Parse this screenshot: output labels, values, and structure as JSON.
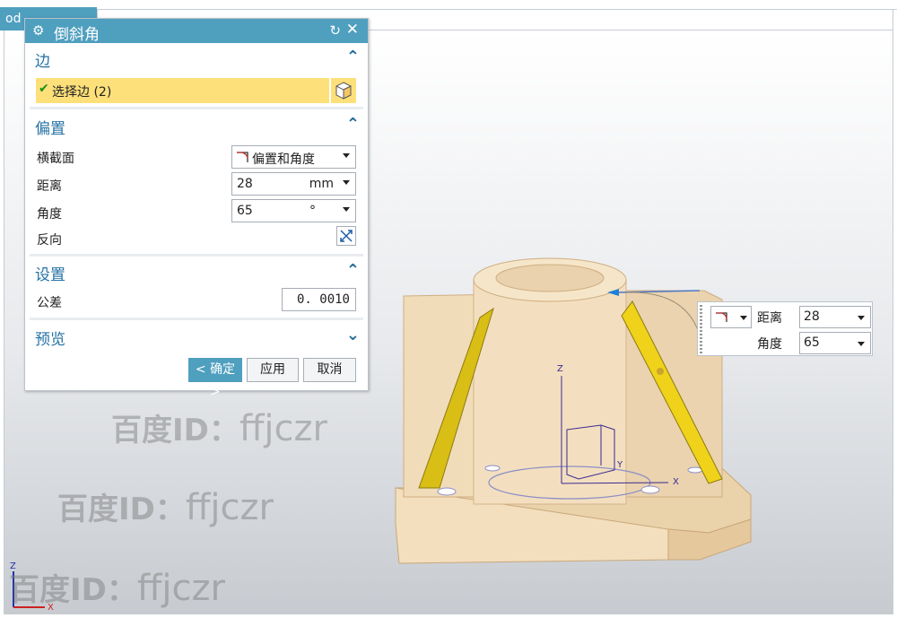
{
  "tab": {
    "doc_label": "od"
  },
  "dialog": {
    "title": "倒斜角",
    "sections": {
      "edge": {
        "title": "边",
        "select_label": "选择边 (2)"
      },
      "offset": {
        "title": "偏置",
        "cross_section_label": "横截面",
        "cross_section_value": "偏置和角度",
        "distance_label": "距离",
        "distance_value": "28",
        "distance_unit": "mm",
        "angle_label": "角度",
        "angle_value": "65",
        "angle_unit": "°",
        "reverse_label": "反向"
      },
      "settings": {
        "title": "设置",
        "tolerance_label": "公差",
        "tolerance_value": "0. 0010"
      },
      "preview": {
        "title": "预览"
      }
    },
    "buttons": {
      "ok": "< 确定 >",
      "apply": "应用",
      "cancel": "取消"
    }
  },
  "onscreen_input": {
    "distance_label": "距离",
    "distance_value": "28",
    "angle_label": "角度",
    "angle_value": "65"
  },
  "triad": {
    "x": "X",
    "y": "Y",
    "z": "Z"
  },
  "watermarks": [
    {
      "cn": "百度ID：",
      "latin": "ffjczr"
    },
    {
      "cn": "百度ID：",
      "latin": "ffjczr"
    },
    {
      "cn": "百度ID：",
      "latin": "ffjczr"
    }
  ],
  "colors": {
    "title_bar": "#4f9fbf",
    "section_title": "#2472a4",
    "selection_highlight": "#fde07a",
    "part_body": "#f1dcb9",
    "chamfer_face": "#f0d21a"
  }
}
